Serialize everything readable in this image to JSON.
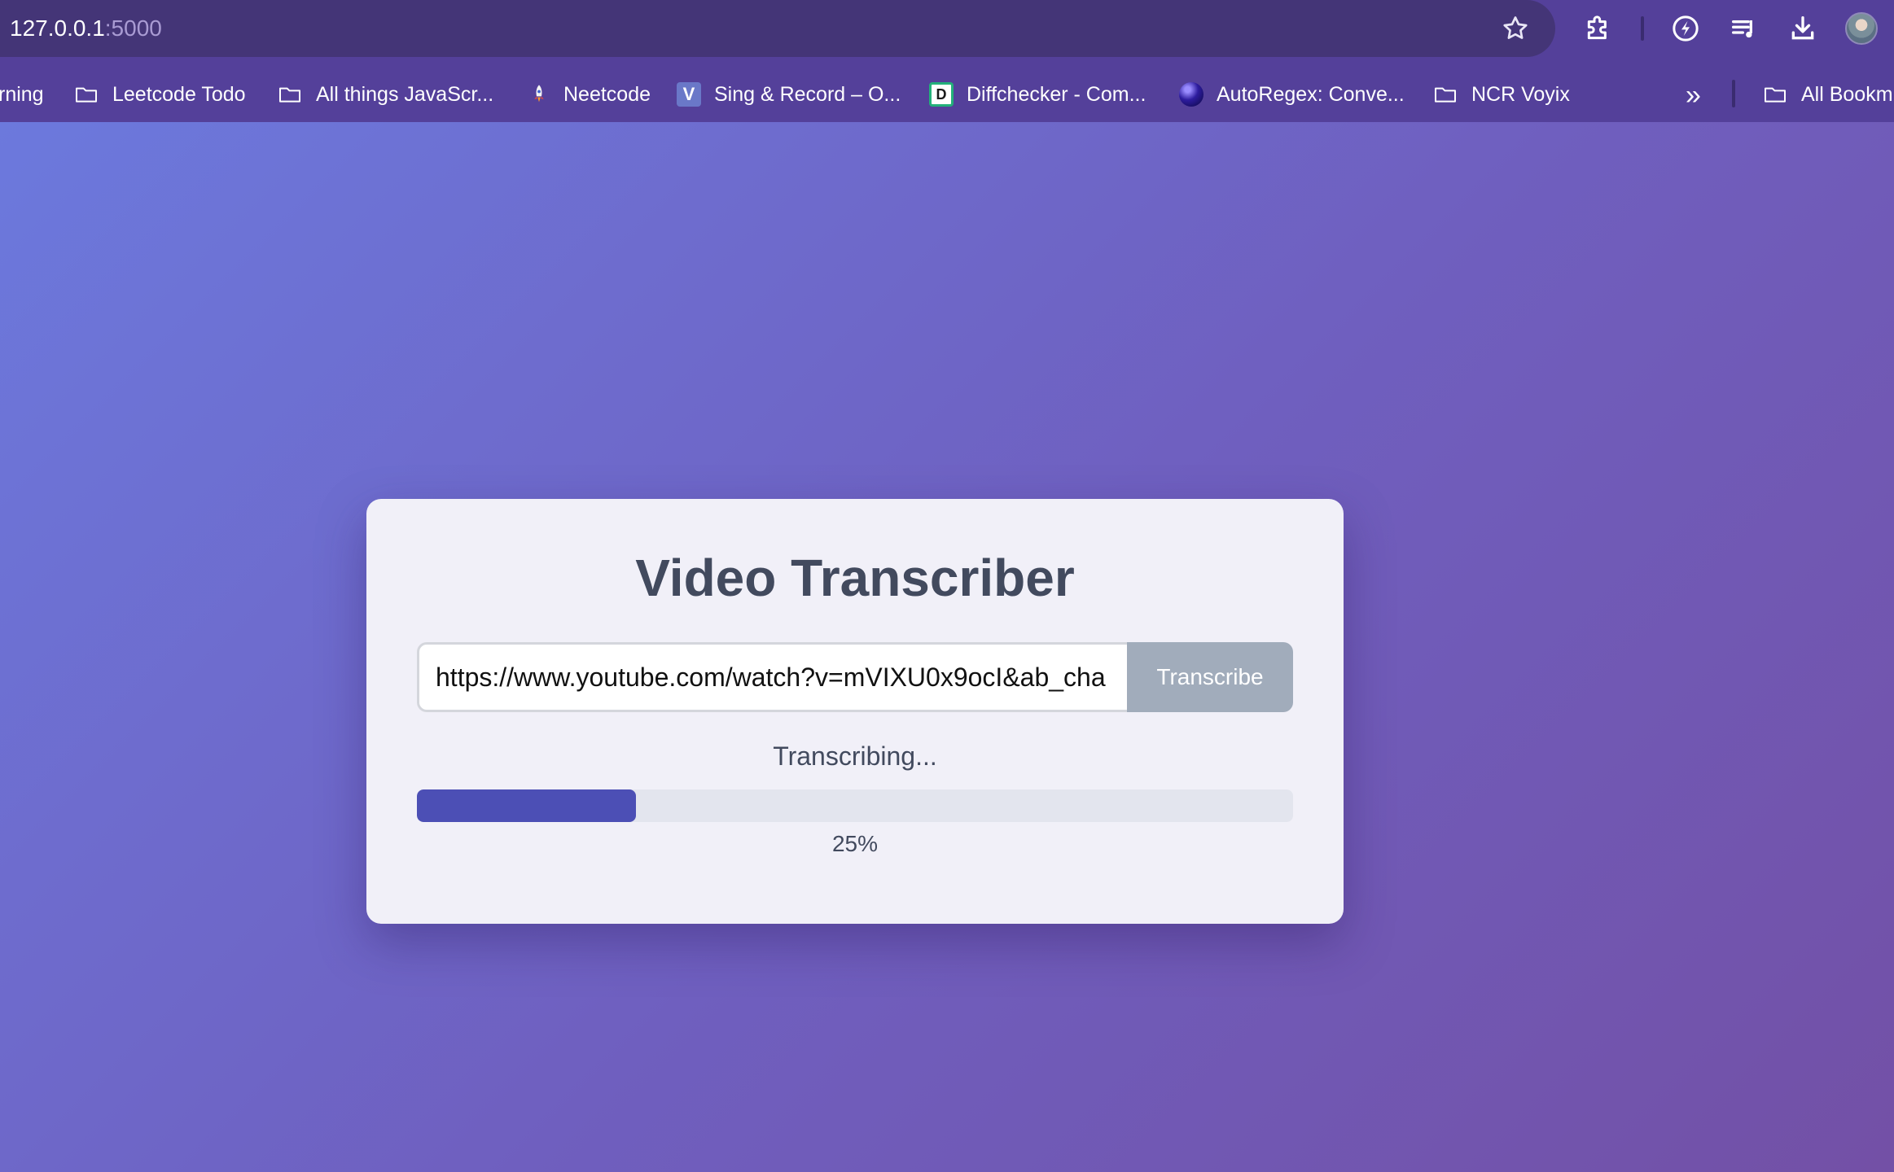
{
  "browser": {
    "url_host": "127.0.0.1",
    "url_port": ":5000",
    "toolbar_icons": [
      "star-icon",
      "extensions-icon",
      "performance-icon",
      "media-controls-icon",
      "download-icon",
      "profile-avatar"
    ],
    "bookmarks": [
      {
        "label": "rning",
        "icon": "folder-icon"
      },
      {
        "label": "Leetcode Todo",
        "icon": "folder-icon"
      },
      {
        "label": "All things JavaScr...",
        "icon": "folder-icon"
      },
      {
        "label": "Neetcode",
        "icon": "rocket-icon"
      },
      {
        "label": "Sing & Record – O...",
        "icon": "v-favicon",
        "glyph": "V"
      },
      {
        "label": "Diffchecker - Com...",
        "icon": "d-favicon",
        "glyph": "D"
      },
      {
        "label": "AutoRegex: Conve...",
        "icon": "sphere-favicon"
      },
      {
        "label": "NCR Voyix",
        "icon": "folder-icon"
      },
      {
        "label": "All Bookm",
        "icon": "folder-icon"
      }
    ],
    "more_bookmarks_glyph": "»"
  },
  "app": {
    "title": "Video Transcriber",
    "url_value": "https://www.youtube.com/watch?v=mVIXU0x9ocI&ab_cha",
    "transcribe_label": "Transcribe",
    "status_text": "Transcribing...",
    "progress_fraction": 0.25,
    "progress_label": "25%"
  },
  "colors": {
    "background_start": "#6c7bdf",
    "background_end": "#7350a6",
    "progress_fill": "#4c4fb5",
    "button_disabled": "#a1acbb"
  }
}
